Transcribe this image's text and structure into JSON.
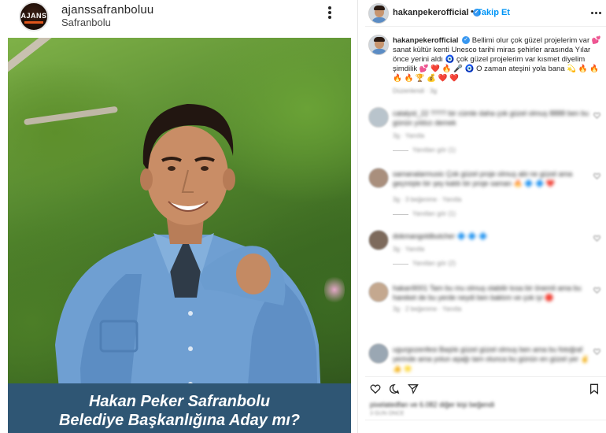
{
  "left_post": {
    "username": "ajanssafranboluu",
    "location": "Safranbolu",
    "avatar_logo": "AJANS",
    "more_icon": "more-vertical-icon",
    "headline_line1": "Hakan Peker Safranbolu",
    "headline_line2": "Belediye Başkanlığına Aday mı?",
    "banner_color": "#2f5674"
  },
  "right_post": {
    "username": "hakanpekerofficial",
    "separator": "•",
    "follow_label": "Takip Et",
    "verified_icon": "verified-badge-icon",
    "more_icon": "more-horizontal-icon",
    "caption_username": "hakanpekerofficial",
    "caption_text": "Bellimi olur çok güzel projelerim var 💕 sanat kültür kenti Unesco tarihi miras şehirler arasında Yılar önce yerini aldı 🧿 çok güzel projelerim var kısmet diyelim şimdilik 💕 ❤️ 🔥 🎤 🧿 O zaman ateşini yola bana 💫 🔥 🔥 🔥 🔥 🏆 💰 ❤️ ❤️",
    "caption_meta": "Düzenlendi · 3g",
    "action_icons": [
      "heart-icon",
      "comment-icon",
      "share-icon",
      "bookmark-icon"
    ],
    "likes_text": "pixelatedfan ve 6.082 diğer kişi beğendi",
    "time_ago": "3 GÜN ÖNCE",
    "link_color": "#0095f6",
    "comments": [
      {
        "text": "catalyst_22 ???? bir cümle daha çok güzel olmuş 8888 ben bu günün yıldızı demek",
        "meta": "3g · Yanıtla",
        "reply": "Yanıtları gör (1)"
      },
      {
        "text": "samanalarmusic Çok güzel proje olmuş abi ne güzel ama geçmişte bir şey kaldı bir proje saman 🔥 🔷 🔷 ❤️",
        "meta": "3g · 3 beğenme · Yanıtla",
        "reply": "Yanıtları gör (1)"
      },
      {
        "text": "dokmangoldbutcher 🔷 🔷 🔷",
        "meta": "3g · Yanıtla",
        "reply": "Yanıtları gör (2)"
      },
      {
        "text": "hakan9001 Tam bu mu olmuş olabilir kısa bir önemli ama bu hareket de bu yerde neydi ben baktım ve çok iyi 🔴",
        "meta": "3g · 2 beğenme · Yanıtla",
        "reply": ""
      },
      {
        "text": "ugurgozenfesi Başlık güzel güzel olmuş ben ama bu fotoğraf yerinde ama yolun aşağı tam olunca bu günün en güzel yer ✌️ 👍 🌟",
        "meta": "3g · Yanıtla",
        "reply": ""
      }
    ]
  }
}
